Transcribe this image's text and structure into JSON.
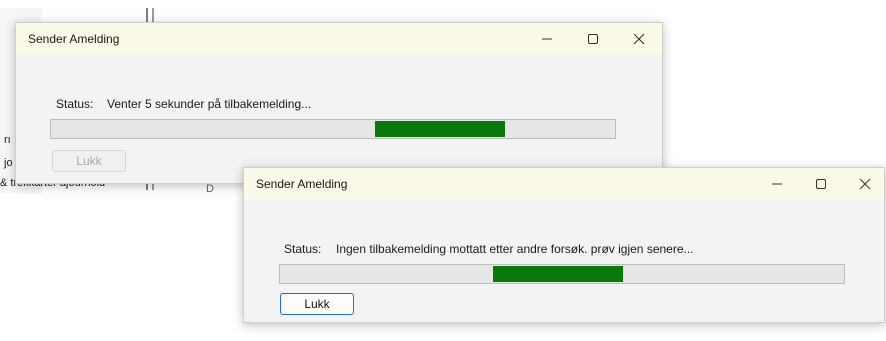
{
  "background_app": {
    "fragments": [
      "rı",
      "jo",
      "& trekkarter ajourhold",
      "D"
    ]
  },
  "dialog1": {
    "title": "Sender Amelding",
    "minimize": "–",
    "maximize": "☐",
    "close": "✕",
    "status_label": "Status:",
    "status_text": "Venter 5 sekunder på tilbakemelding...",
    "progress_indeterminate": true,
    "close_button": "Lukk",
    "close_button_enabled": false
  },
  "dialog2": {
    "title": "Sender Amelding",
    "minimize": "–",
    "maximize": "☐",
    "close": "✕",
    "status_label": "Status:",
    "status_text": "Ingen tilbakemelding mottatt etter andre forsøk. prøv igjen senere...",
    "progress_indeterminate": true,
    "close_button": "Lukk",
    "close_button_enabled": true
  },
  "colors": {
    "progress_fill": "#0b780b",
    "titlebar": "#fbf9e8",
    "focus_border": "#1e6fd1"
  }
}
